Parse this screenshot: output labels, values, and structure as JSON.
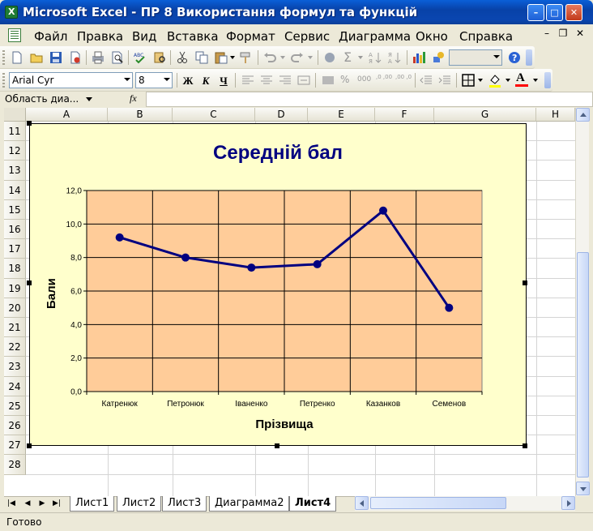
{
  "window": {
    "title": "Microsoft Excel - ПР 8 Використання формул та функцій"
  },
  "menu": {
    "items": [
      "Файл",
      "Правка",
      "Вид",
      "Вставка",
      "Формат",
      "Сервис",
      "Диаграмма",
      "Окно",
      "Справка"
    ]
  },
  "toolbar": {
    "font_name": "Arial Cyr",
    "font_size": "8",
    "bold_label": "Ж",
    "italic_label": "К",
    "underline_label": "Ч",
    "percent_label": "%",
    "thousands_label": "000",
    "dec_inc_label": ",0 ,00",
    "dec_dec_label": ",00 ,0",
    "sigma_label": "Σ",
    "font_color_label": "A",
    "font_color": "#FF0000"
  },
  "formula_bar": {
    "name_box": "Область диа...",
    "fx_label": "fx",
    "formula": ""
  },
  "grid": {
    "columns": [
      "A",
      "B",
      "C",
      "D",
      "E",
      "F",
      "G",
      "H"
    ],
    "rows": [
      "11",
      "12",
      "13",
      "14",
      "15",
      "16",
      "17",
      "18",
      "19",
      "20",
      "21",
      "22",
      "23",
      "24",
      "25",
      "26",
      "27",
      "28"
    ]
  },
  "chart_data": {
    "type": "line",
    "title": "Середній бал",
    "xlabel": "Прізвища",
    "ylabel": "Бали",
    "categories": [
      "Катренюк",
      "Петронюк",
      "Іваненко",
      "Петренко",
      "Казанков",
      "Семенов"
    ],
    "series": [
      {
        "values": [
          9.2,
          8.0,
          7.4,
          7.6,
          10.8,
          5.0
        ],
        "color": "#000080"
      }
    ],
    "ylim": [
      0,
      12
    ],
    "ytick_labels": [
      "0,0",
      "2,0",
      "4,0",
      "6,0",
      "8,0",
      "10,0",
      "12,0"
    ],
    "grid": true,
    "plot_background": "#FFCC99",
    "chart_background": "#FFFFCC",
    "title_color": "#000080"
  },
  "sheets": {
    "tabs": [
      "Лист1",
      "Лист2",
      "Лист3",
      "Диаграмма2",
      "Лист4"
    ],
    "active": "Лист4"
  },
  "status": {
    "text": "Готово"
  }
}
